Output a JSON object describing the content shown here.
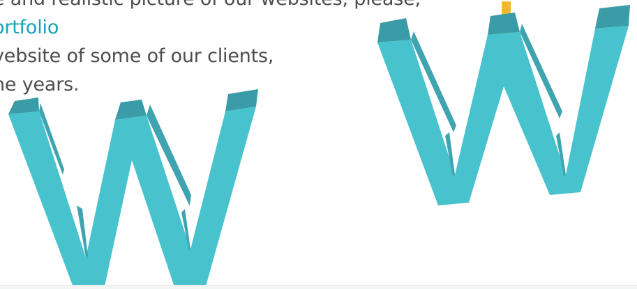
{
  "intro": {
    "line1": "e and realistic picture of our websites, please,",
    "link": "ortfolio",
    "line3": "vebsite of some of our clients,",
    "line4": "ne years."
  },
  "decor": {
    "shape1": "letter-w-3d",
    "shape2": "letter-w-3d",
    "face_color": "#48c3cd",
    "side_color": "#3fa4b0",
    "top_color": "#3a9ca6",
    "accent_color": "#f3b82d"
  }
}
